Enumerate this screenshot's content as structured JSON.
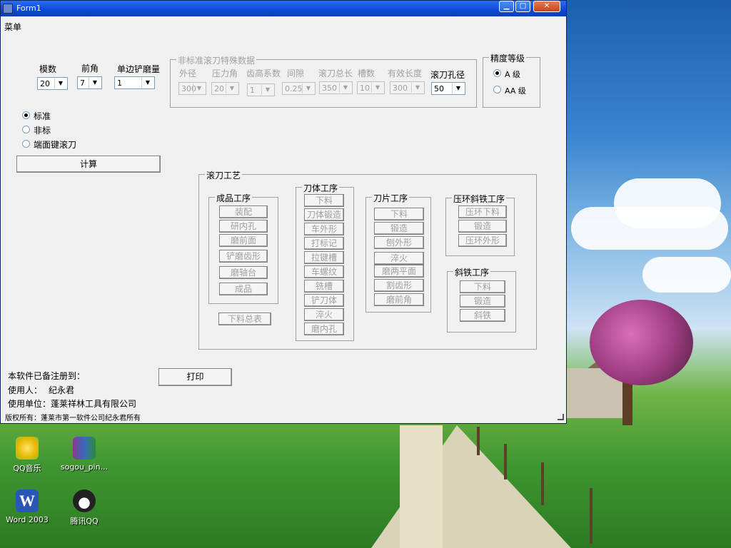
{
  "window": {
    "title": "Form1",
    "menu": "菜单",
    "title_buttons": {
      "minimize": "▁",
      "maximize": "□",
      "close": "✕"
    }
  },
  "params": {
    "module_label": "模数",
    "module_value": "20",
    "rake_label": "前角",
    "rake_value": "7",
    "shovel_label": "单边铲磨量",
    "shovel_value": "1"
  },
  "nonstandard": {
    "title": "非标准滚刀特殊数据",
    "fields": [
      {
        "label": "外径",
        "value": "300"
      },
      {
        "label": "压力角",
        "value": "20"
      },
      {
        "label": "齿高系数",
        "value": "1"
      },
      {
        "label": "间隙",
        "value": "0.25"
      },
      {
        "label": "滚刀总长",
        "value": "350"
      },
      {
        "label": "槽数",
        "value": "10"
      },
      {
        "label": "有效长度",
        "value": "300"
      }
    ],
    "bore_label": "滚刀孔径",
    "bore_value": "50"
  },
  "precision": {
    "title": "精度等级",
    "options": [
      "A 级",
      "AA 级"
    ],
    "selected": "A 级"
  },
  "type_options": {
    "options": [
      "标准",
      "非标",
      "端面键滚刀"
    ],
    "selected": "标准"
  },
  "calc_button": "计算",
  "process": {
    "title": "滚刀工艺",
    "finished": {
      "title": "成品工序",
      "items": [
        "装配",
        "研内孔",
        "磨前面",
        "铲磨齿形",
        "磨轴台",
        "成品"
      ]
    },
    "material_summary": "下料总表",
    "body": {
      "title": "刀体工序",
      "items": [
        "下料",
        "刀体锻造",
        "车外形",
        "打标记",
        "拉键槽",
        "车螺纹",
        "铣槽",
        "铲刀体",
        "淬火",
        "磨内孔"
      ]
    },
    "blade": {
      "title": "刀片工序",
      "items": [
        "下料",
        "锻造",
        "刨外形",
        "淬火",
        "磨两平面",
        "割齿形",
        "磨前角"
      ]
    },
    "ring": {
      "title": "压环斜铁工序",
      "items": [
        "压环下料",
        "锻造",
        "压环外形"
      ]
    },
    "wedge": {
      "title": "斜铁工序",
      "items": [
        "下料",
        "锻造",
        "斜铁"
      ]
    }
  },
  "registration": {
    "heading": "本软件已备注册到：",
    "user_label": "使用人：",
    "user_name": "纪永君",
    "unit_label": "使用单位：",
    "unit_name": "蓬莱祥林工具有限公司",
    "copyright": "版权所有：蓬莱市第一软件公司纪永君所有"
  },
  "print_button": "打印",
  "desktop_icons": [
    {
      "label": "QQ音乐",
      "icon": "qq-music-icon",
      "color": "#f4c81a"
    },
    {
      "label": "sogou_pin...",
      "icon": "winrar-icon",
      "color": "#8a3a8a"
    },
    {
      "label": "Word 2003",
      "icon": "word-icon",
      "color": "#2a57b5"
    },
    {
      "label": "腾讯QQ",
      "icon": "qq-penguin-icon",
      "color": "#222222"
    }
  ]
}
